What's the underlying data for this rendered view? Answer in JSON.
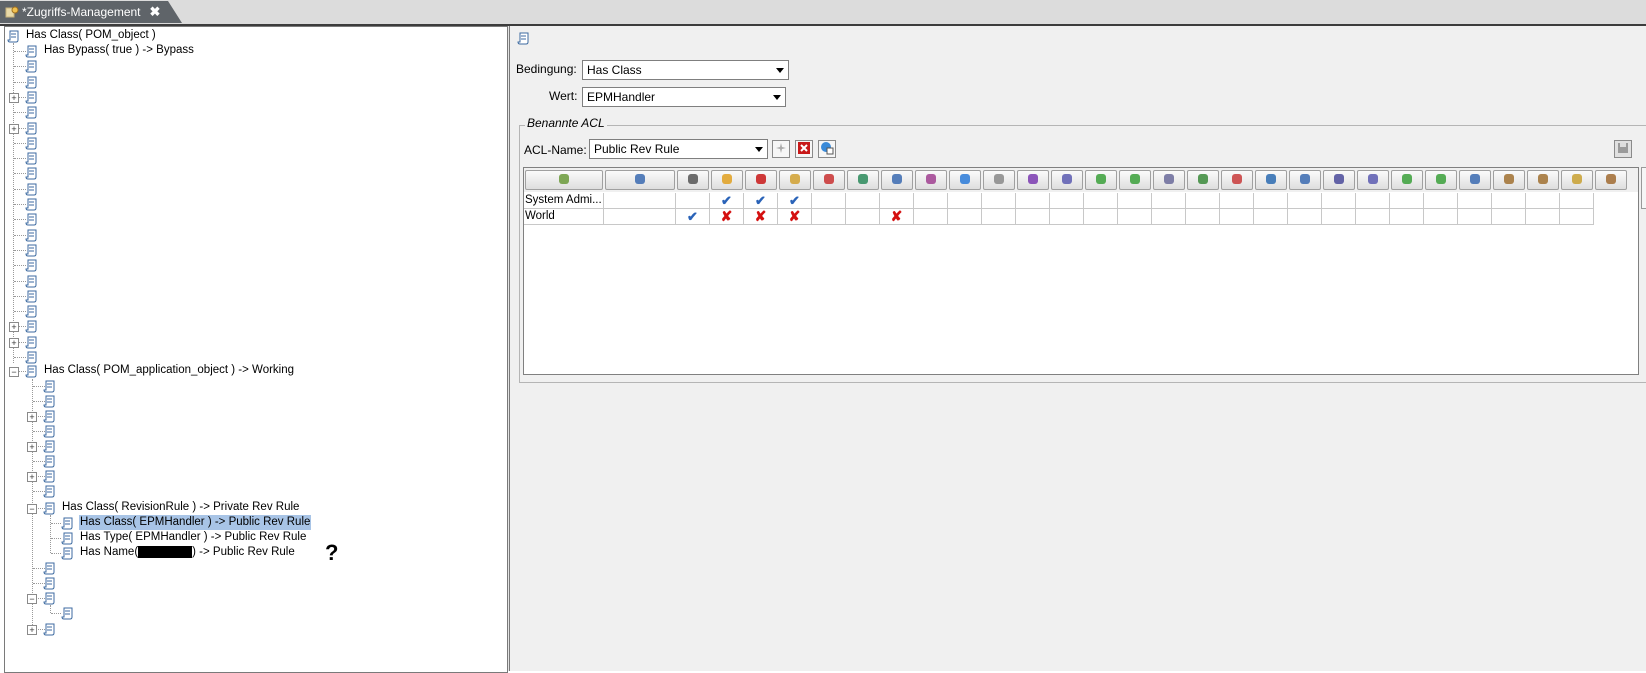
{
  "tab": {
    "title": "*Zugriffs-Management",
    "close": "✖"
  },
  "tree": {
    "root_label": "Has Class( POM_object )",
    "bypass_label": "Has Bypass( true ) -> Bypass",
    "app_object_label": "Has Class( POM_application_object ) -> Working",
    "revision_rule_label": "Has Class( RevisionRule ) -> Private Rev Rule",
    "epm_class_label": "Has Class( EPMHandler ) -> Public Rev Rule",
    "epm_type_label": "Has Type( EPMHandler ) -> Public Rev Rule",
    "name_prefix": "Has Name(",
    "name_suffix": ") -> Public Rev Rule",
    "question_mark": "?"
  },
  "form": {
    "condition_label": "Bedingung:",
    "condition_value": "Has Class",
    "value_label": "Wert:",
    "value_value": "EPMHandler",
    "group_title": "Benannte ACL",
    "acl_name_label": "ACL-Name:",
    "acl_name_value": "Public Rev Rule"
  },
  "acl_table": {
    "rows": [
      {
        "name": "System Admi...",
        "marks": [
          "",
          "check",
          "check",
          "check",
          "",
          "",
          "",
          "",
          "",
          "",
          "",
          "",
          "",
          "",
          "",
          "",
          "",
          "",
          "",
          "",
          "",
          "",
          "",
          "",
          "",
          "",
          ""
        ]
      },
      {
        "name": "World",
        "marks": [
          "check",
          "x",
          "x",
          "x",
          "",
          "",
          "x",
          "",
          "",
          "",
          "",
          "",
          "",
          "",
          "",
          "",
          "",
          "",
          "",
          "",
          "",
          "",
          "",
          "",
          "",
          "",
          ""
        ]
      }
    ],
    "header_icons": [
      "role-icon",
      "user-icon",
      "read-icon",
      "write-icon",
      "delete-icon",
      "change-ownership-icon",
      "promote-icon",
      "demote-icon",
      "copy-icon",
      "assign-icon",
      "publish-icon",
      "remote-checkout-icon",
      "change-icon",
      "write-classification-icon",
      "export-icon",
      "import-icon",
      "transfer-out-icon",
      "transfer-in-icon",
      "ip-admin-icon",
      "translation-icon",
      "remote-site-icon",
      "batch-icon",
      "markup-icon",
      "subscribe-icon",
      "add-content-icon",
      "digital-sign-icon",
      "administer-icon",
      "unmanage-icon",
      "itar-icon",
      "configure-icon"
    ],
    "colors": {
      "check": "#2a63b8",
      "x": "#d41010"
    }
  }
}
